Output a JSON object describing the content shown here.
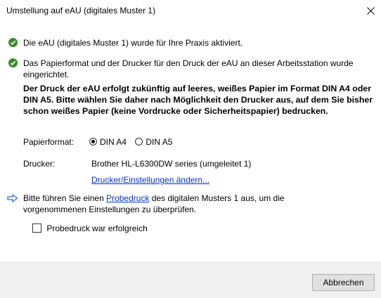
{
  "window": {
    "title": "Umstellung auf eAU (digitales Muster 1)"
  },
  "messages": {
    "activated": "Die eAU (digitales Muster 1) wurde für Ihre Praxis aktiviert.",
    "setup": "Das Papierformat und der Drucker für den Druck der eAU an dieser Arbeitsstation wurde eingerichtet.",
    "notice": "Der Druck der eAU erfolgt zukünftig auf leeres, weißes Papier im Format DIN A4 oder DIN A5. Bitte wählen Sie daher nach Möglichkeit den Drucker aus, auf dem Sie bisher schon weißes Papier (keine Vordrucke oder Sicherheitspapier) bedrucken."
  },
  "paper_format": {
    "label": "Papierformat:",
    "options": [
      "DIN A4",
      "DIN A5"
    ],
    "selected": "DIN A4"
  },
  "printer": {
    "label": "Drucker:",
    "value": "Brother HL-L6300DW series (umgeleitet 1)",
    "settings_link": "Drucker/Einstellungen ändern..."
  },
  "test_print": {
    "text_before": "Bitte führen Sie einen ",
    "link": "Probedruck",
    "text_after_line1": " des digitalen Musters 1 aus, um die",
    "text_line2": "vorgenommenen Einstellungen zu überprüfen.",
    "checkbox_label": "Probedruck war erfolgreich",
    "checkbox_checked": false
  },
  "buttons": {
    "cancel": "Abbrechen"
  },
  "colors": {
    "check_green": "#3a8a2a",
    "arrow_blue": "#2b6cd4",
    "link_blue": "#0033cc",
    "footer_bg": "#f0f0f0"
  }
}
